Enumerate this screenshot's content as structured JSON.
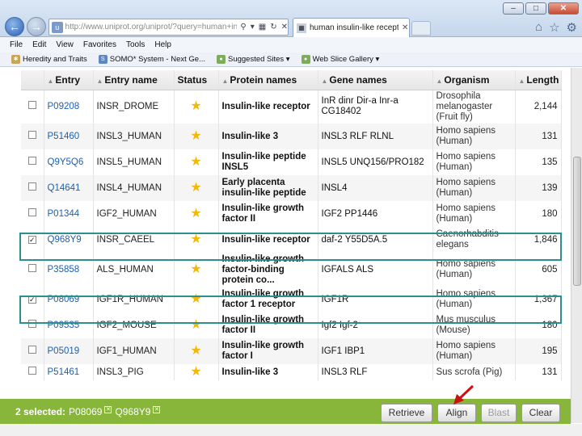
{
  "browser": {
    "url": "http://www.uniprot.org/uniprot/?query=human+insul",
    "tab_title": "human insulin-like recepto...",
    "menu": [
      "File",
      "Edit",
      "View",
      "Favorites",
      "Tools",
      "Help"
    ],
    "favorites": [
      "Heredity and Traits",
      "SOMO* System - Next Ge...",
      "Suggested Sites ▾",
      "Web Slice Gallery ▾"
    ]
  },
  "table": {
    "headers": {
      "entry": "Entry",
      "entry_name": "Entry name",
      "status": "Status",
      "protein": "Protein names",
      "gene": "Gene names",
      "organism": "Organism",
      "length": "Length"
    },
    "rows": [
      {
        "entry": "P09208",
        "name": "INSR_DROME",
        "protein": "Insulin-like receptor",
        "gene": "InR dinr Dir-a Inr-a CG18402",
        "organism": "Drosophila melanogaster (Fruit fly)",
        "length": "2,144",
        "checked": false
      },
      {
        "entry": "P51460",
        "name": "INSL3_HUMAN",
        "protein": "Insulin-like 3",
        "gene": "INSL3 RLF RLNL",
        "organism": "Homo sapiens (Human)",
        "length": "131",
        "checked": false
      },
      {
        "entry": "Q9Y5Q6",
        "name": "INSL5_HUMAN",
        "protein": "Insulin-like peptide INSL5",
        "gene": "INSL5 UNQ156/PRO182",
        "organism": "Homo sapiens (Human)",
        "length": "135",
        "checked": false
      },
      {
        "entry": "Q14641",
        "name": "INSL4_HUMAN",
        "protein": "Early placenta insulin-like peptide",
        "gene": "INSL4",
        "organism": "Homo sapiens (Human)",
        "length": "139",
        "checked": false
      },
      {
        "entry": "P01344",
        "name": "IGF2_HUMAN",
        "protein": "Insulin-like growth factor II",
        "gene": "IGF2 PP1446",
        "organism": "Homo sapiens (Human)",
        "length": "180",
        "checked": false
      },
      {
        "entry": "Q968Y9",
        "name": "INSR_CAEEL",
        "protein": "Insulin-like receptor",
        "gene": "daf-2 Y55D5A.5",
        "organism": "Caenorhabditis elegans",
        "length": "1,846",
        "checked": true
      },
      {
        "entry": "P35858",
        "name": "ALS_HUMAN",
        "protein": "Insulin-like growth factor-binding protein co...",
        "gene": "IGFALS ALS",
        "organism": "Homo sapiens (Human)",
        "length": "605",
        "checked": false
      },
      {
        "entry": "P08069",
        "name": "IGF1R_HUMAN",
        "protein": "Insulin-like growth factor 1 receptor",
        "gene": "IGF1R",
        "organism": "Homo sapiens (Human)",
        "length": "1,367",
        "checked": true
      },
      {
        "entry": "P09535",
        "name": "IGF2_MOUSE",
        "protein": "Insulin-like growth factor II",
        "gene": "Igf2 Igf-2",
        "organism": "Mus musculus (Mouse)",
        "length": "180",
        "checked": false
      },
      {
        "entry": "P05019",
        "name": "IGF1_HUMAN",
        "protein": "Insulin-like growth factor I",
        "gene": "IGF1 IBP1",
        "organism": "Homo sapiens (Human)",
        "length": "195",
        "checked": false
      },
      {
        "entry": "P51461",
        "name": "INSL3_PIG",
        "protein": "Insulin-like 3",
        "gene": "INSL3 RLF",
        "organism": "Sus scrofa (Pig)",
        "length": "131",
        "checked": false
      }
    ]
  },
  "selection": {
    "summary": "2 selected:",
    "ids": [
      "P08069",
      "Q968Y9"
    ]
  },
  "actions": {
    "retrieve": "Retrieve",
    "align": "Align",
    "blast": "Blast",
    "clear": "Clear"
  },
  "colors": {
    "action_bar": "#88b63b",
    "selection_outline": "#2b8f8f",
    "link": "#1d5fae",
    "star": "#f2b80a",
    "annotation_arrow": "#cc1111"
  }
}
